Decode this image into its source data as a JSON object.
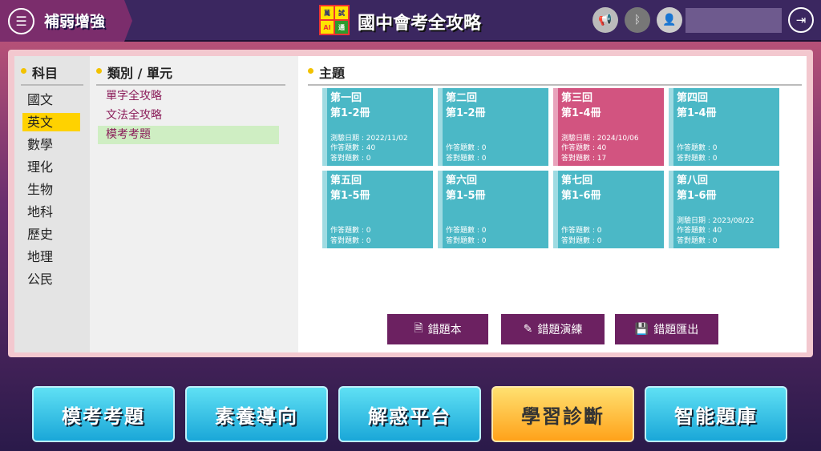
{
  "header": {
    "menu_label": "補弱增強",
    "logo_cells": [
      "萬",
      "試",
      "AI",
      "通"
    ],
    "app_title": "國中會考全攻略",
    "icons": [
      "megaphone-icon",
      "bluetooth-icon",
      "user-icon",
      "logout-icon"
    ]
  },
  "subjects": {
    "heading": "科目",
    "items": [
      "國文",
      "英文",
      "數學",
      "理化",
      "生物",
      "地科",
      "歷史",
      "地理",
      "公民"
    ],
    "selected": "英文"
  },
  "categories": {
    "heading": "類別 / 單元",
    "items": [
      "單字全攻略",
      "文法全攻略",
      "模考考題"
    ],
    "selected": "模考考題"
  },
  "topics": {
    "heading": "主題",
    "cards": [
      {
        "title": "第一回",
        "range": "第1-2冊",
        "date": "測驗日期 : 2022/11/02",
        "answered": "作答題數 : 40",
        "correct": "答對題數 : 0"
      },
      {
        "title": "第二回",
        "range": "第1-2冊",
        "answered": "作答題數 : 0",
        "correct": "答對題數 : 0"
      },
      {
        "title": "第三回",
        "range": "第1-4冊",
        "date": "測驗日期 : 2024/10/06",
        "answered": "作答題數 : 40",
        "correct": "答對題數 : 17",
        "highlight": true
      },
      {
        "title": "第四回",
        "range": "第1-4冊",
        "answered": "作答題數 : 0",
        "correct": "答對題數 : 0"
      },
      {
        "title": "第五回",
        "range": "第1-5冊",
        "answered": "作答題數 : 0",
        "correct": "答對題數 : 0"
      },
      {
        "title": "第六回",
        "range": "第1-5冊",
        "answered": "作答題數 : 0",
        "correct": "答對題數 : 0"
      },
      {
        "title": "第七回",
        "range": "第1-6冊",
        "answered": "作答題數 : 0",
        "correct": "答對題數 : 0"
      },
      {
        "title": "第八回",
        "range": "第1-6冊",
        "date": "測驗日期 : 2023/08/22",
        "answered": "作答題數 : 40",
        "correct": "答對題數 : 0"
      }
    ]
  },
  "actions": [
    "錯題本",
    "錯題演練",
    "錯題匯出"
  ],
  "bottom_nav": {
    "items": [
      "模考考題",
      "素養導向",
      "解惑平台",
      "學習診斷",
      "智能題庫"
    ],
    "active": "學習診斷"
  },
  "colors": {
    "header": "#3b2760",
    "card": "#4bb8c6",
    "card_highlight": "#d25480",
    "action": "#6c2161"
  }
}
